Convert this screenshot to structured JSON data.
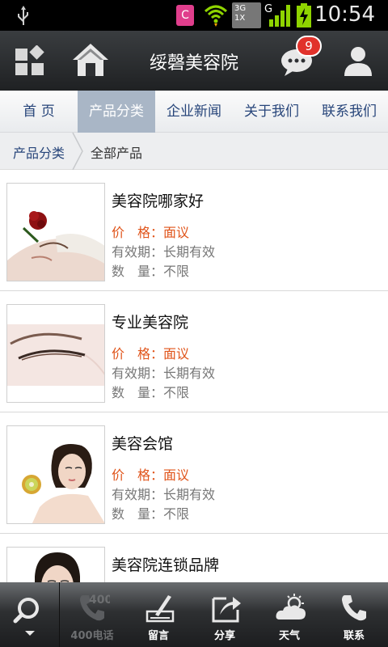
{
  "status_bar": {
    "time": "10:54",
    "notification_letter": "C",
    "network_badge": "3G\n1X",
    "signal_label": "G"
  },
  "header": {
    "title": "绥磬美容院",
    "message_badge": "9"
  },
  "nav": {
    "tabs": [
      {
        "label": "首 页",
        "active": false
      },
      {
        "label": "产品分类",
        "active": true
      },
      {
        "label": "企业新闻",
        "active": false
      },
      {
        "label": "关于我们",
        "active": false
      },
      {
        "label": "联系我们",
        "active": false
      }
    ]
  },
  "breadcrumb": {
    "parent": "产品分类",
    "current": "全部产品"
  },
  "products": [
    {
      "name": "美容院哪家好",
      "price": "价　格：面议",
      "validity": "有效期：长期有效",
      "quantity": "数　量：不限",
      "image": "rose-face-photo"
    },
    {
      "name": "专业美容院",
      "price": "价　格：面议",
      "validity": "有效期：长期有效",
      "quantity": "数　量：不限",
      "image": "eye-closeup-photo"
    },
    {
      "name": "美容会馆",
      "price": "价　格：面议",
      "validity": "有效期：长期有效",
      "quantity": "数　量：不限",
      "image": "woman-kiwi-photo"
    },
    {
      "name": "美容院连锁品牌",
      "price": "",
      "validity": "",
      "quantity": "",
      "image": "woman-portrait-photo"
    }
  ],
  "bottom_bar": {
    "items": [
      {
        "label": "400电话",
        "icon": "phone-400-icon",
        "enabled": false,
        "icon_text": "400"
      },
      {
        "label": "留言",
        "icon": "write-pen-icon",
        "enabled": true
      },
      {
        "label": "分享",
        "icon": "share-arrow-icon",
        "enabled": true
      },
      {
        "label": "天气",
        "icon": "weather-cloud-icon",
        "enabled": true
      },
      {
        "label": "联系",
        "icon": "phone-icon",
        "enabled": true
      }
    ]
  },
  "colors": {
    "nav_text": "#27457a",
    "nav_active_bg": "#a9b6c6",
    "price_text": "#e0541a",
    "badge_red": "#e1322b"
  }
}
